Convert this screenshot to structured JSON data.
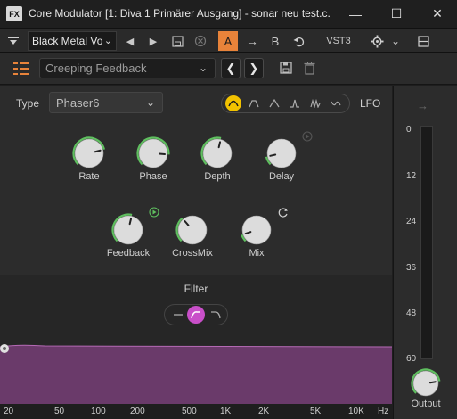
{
  "window": {
    "fx_badge": "FX",
    "title": "Core Modulator [1: Diva 1 Primärer Ausgang] - sonar neu test.c...",
    "minimize_glyph": "—",
    "maximize_glyph": "☐",
    "close_glyph": "✕"
  },
  "toolbar": {
    "preset_name": "Black Metal Vo",
    "prev_glyph": "◀",
    "next_glyph": "▶",
    "ab_a": "A",
    "ab_arrow": "→",
    "ab_b": "B",
    "format": "VST3"
  },
  "header": {
    "fx_preset": "Creeping Feedback",
    "prev_glyph": "❮",
    "next_glyph": "❯"
  },
  "main": {
    "type_label": "Type",
    "type_value": "Phaser6",
    "lfo_label": "LFO",
    "knobs": [
      {
        "label": "Rate",
        "value": 0.78
      },
      {
        "label": "Phase",
        "value": 0.85
      },
      {
        "label": "Depth",
        "value": 0.55
      },
      {
        "label": "Delay",
        "value": 0.12
      },
      {
        "label": "Feedback",
        "value": 0.55
      },
      {
        "label": "CrossMix",
        "value": 0.35
      },
      {
        "label": "Mix",
        "value": 0.1
      }
    ]
  },
  "filter": {
    "label": "Filter",
    "freq_ticks": [
      "20",
      "50",
      "100",
      "200",
      "500",
      "1K",
      "2K",
      "5K",
      "10K",
      "Hz"
    ]
  },
  "output": {
    "arrow_glyph": "→",
    "db_ticks": [
      "0",
      "12",
      "24",
      "36",
      "48",
      "60"
    ],
    "label": "Output",
    "knob_value": 0.8
  },
  "colors": {
    "accent": "#e8833a",
    "lfo_active": "#f2c200",
    "knob_ring": "#5fbf5f",
    "filter_fill": "#6a3a6a",
    "filter_active": "#c94fc9"
  }
}
